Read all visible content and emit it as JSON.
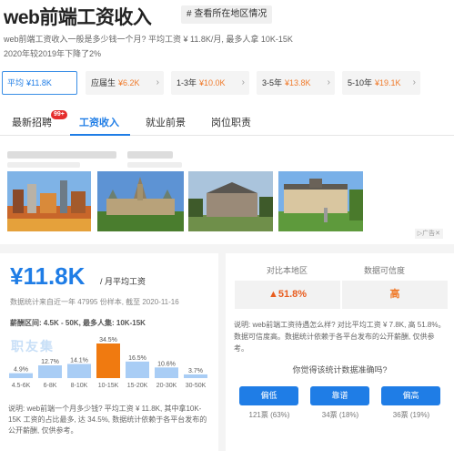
{
  "header": {
    "title": "web前端工资收入",
    "region_link": "# 查看所在地区情况",
    "desc_line1": "web前端工资收入一般是多少钱一个月? 平均工资 ¥ 11.8K/月, 最多人拿 10K-15K",
    "desc_line2": "2020年较2019年下降了2%"
  },
  "chips": [
    {
      "label": "平均",
      "salary": "¥11.8K",
      "active": true
    },
    {
      "label": "应届生",
      "salary": "¥6.2K",
      "arrow": "›"
    },
    {
      "label": "1-3年",
      "salary": "¥10.0K",
      "arrow": "›"
    },
    {
      "label": "3-5年",
      "salary": "¥13.8K",
      "arrow": "›"
    },
    {
      "label": "5-10年",
      "salary": "¥19.1K",
      "arrow": "›"
    }
  ],
  "tabs": [
    {
      "label": "最新招聘",
      "badge": "99+"
    },
    {
      "label": "工资收入",
      "active": true
    },
    {
      "label": "就业前景"
    },
    {
      "label": "岗位职责"
    }
  ],
  "ad": {
    "tag": "▷广告✕"
  },
  "salary": {
    "value": "¥11.8K",
    "unit": "/ 月平均工资",
    "sample": "数据统计来自近一年 47995 份样本, 截至 2020-11-16",
    "range": "薪酬区间: 4.5K - 50K, 最多人集: 10K-15K",
    "watermark": "职友集",
    "explain": "说明: web前端一个月多少钱? 平均工资 ¥ 11.8K, 其中拿10K-15K 工资的占比最多, 达 34.5%, 数据统计依赖于各平台发布的公开薪酬, 仅供参考。"
  },
  "chart_data": {
    "type": "bar",
    "categories": [
      "4.5-6K",
      "6-8K",
      "8-10K",
      "10-15K",
      "15-20K",
      "20-30K",
      "30-50K"
    ],
    "values": [
      4.9,
      12.7,
      14.1,
      34.5,
      16.5,
      10.6,
      3.7
    ],
    "value_labels": [
      "4.9%",
      "12.7%",
      "14.1%",
      "34.5%",
      "16.5%",
      "10.6%",
      "3.7%"
    ],
    "highlight_index": 3,
    "colors": {
      "normal": "#a9cdf5",
      "highlight": "#f07a10"
    }
  },
  "compare": {
    "head_left": "对比本地区",
    "head_right": "数据可信度",
    "value_left": "▲51.8%",
    "value_right": "高",
    "explain": "说明: web前端工资待遇怎么样? 对比平均工资 ¥ 7.8K, 高 51.8%。数据可信度高。数据统计依赖于各平台发布的公开薪酬, 仅供参考。",
    "question": "你觉得该统计数据准确吗?",
    "votes": [
      {
        "label": "偏低",
        "count": "121票 (63%)"
      },
      {
        "label": "靠谱",
        "count": "34票 (18%)"
      },
      {
        "label": "偏高",
        "count": "36票 (19%)"
      }
    ]
  },
  "colors": {
    "accent": "#1f7de6",
    "orange": "#f07a2a",
    "red_up": "#e85d1f"
  }
}
